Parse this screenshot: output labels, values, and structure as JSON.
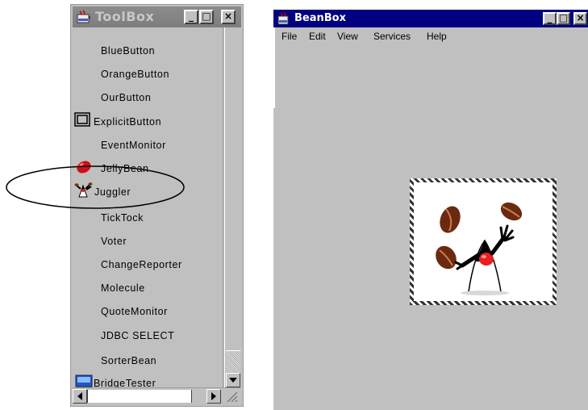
{
  "toolbox": {
    "title": "ToolBox",
    "controls": {
      "minimize": "_",
      "maximize": "□",
      "close": "×"
    },
    "items": [
      {
        "label": "BlueButton",
        "icon": null
      },
      {
        "label": "OrangeButton",
        "icon": null
      },
      {
        "label": "OurButton",
        "icon": null
      },
      {
        "label": "ExplicitButton",
        "icon": "button-frame-icon"
      },
      {
        "label": "EventMonitor",
        "icon": null
      },
      {
        "label": "JellyBean",
        "icon": "jellybean-icon"
      },
      {
        "label": "Juggler",
        "icon": "juggler-icon"
      },
      {
        "label": "TickTock",
        "icon": null
      },
      {
        "label": "Voter",
        "icon": null
      },
      {
        "label": "ChangeReporter",
        "icon": null
      },
      {
        "label": "Molecule",
        "icon": null
      },
      {
        "label": "QuoteMonitor",
        "icon": null
      },
      {
        "label": "JDBC SELECT",
        "icon": null
      },
      {
        "label": "SorterBean",
        "icon": null
      },
      {
        "label": "BridgeTester",
        "icon": "bridge-icon"
      }
    ],
    "highlighted_item": "Juggler"
  },
  "beanbox": {
    "title": "BeanBox",
    "menu": [
      "File",
      "Edit",
      "View",
      "Services",
      "Help"
    ],
    "selected_bean": "Juggler"
  },
  "colors": {
    "window_bg": "#c0c0c0",
    "active_title": "#000080",
    "inactive_title": "#808080",
    "jellybean": "#d01010"
  }
}
